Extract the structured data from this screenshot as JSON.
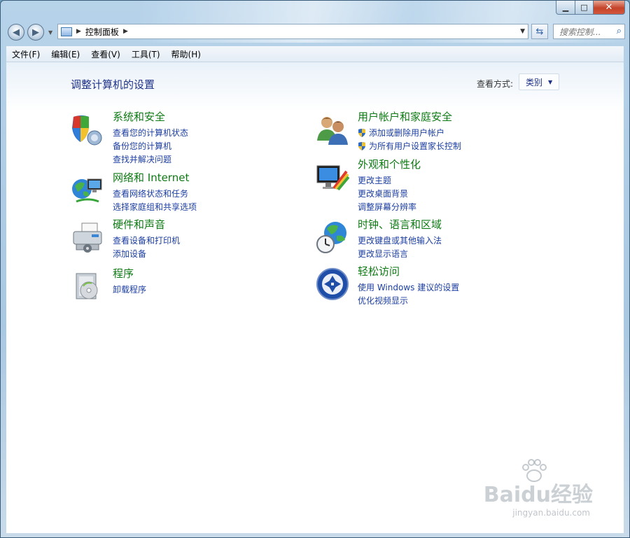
{
  "window": {
    "title": ""
  },
  "caption": {
    "minimize": "▁",
    "maximize": "□",
    "close": "✕"
  },
  "nav": {
    "back_icon": "back-arrow-icon",
    "forward_icon": "forward-arrow-icon",
    "breadcrumb": [
      "控制面板"
    ],
    "search_placeholder": "搜索控制..."
  },
  "menu": [
    "文件(F)",
    "编辑(E)",
    "查看(V)",
    "工具(T)",
    "帮助(H)"
  ],
  "main": {
    "title": "调整计算机的设置",
    "view_by_label": "查看方式:",
    "view_by_value": "类别",
    "categories_left": [
      {
        "icon": "shield-pc-icon",
        "title": "系统和安全",
        "links": [
          "查看您的计算机状态",
          "备份您的计算机",
          "查找并解决问题"
        ]
      },
      {
        "icon": "network-globe-icon",
        "title": "网络和 Internet",
        "links": [
          "查看网络状态和任务",
          "选择家庭组和共享选项"
        ]
      },
      {
        "icon": "printer-icon",
        "title": "硬件和声音",
        "links": [
          "查看设备和打印机",
          "添加设备"
        ]
      },
      {
        "icon": "programs-box-icon",
        "title": "程序",
        "links": [
          "卸载程序"
        ]
      }
    ],
    "categories_right": [
      {
        "icon": "users-icon",
        "title": "用户帐户和家庭安全",
        "links": [
          "添加或删除用户帐户",
          "为所有用户设置家长控制"
        ],
        "shielded": true
      },
      {
        "icon": "display-palette-icon",
        "title": "外观和个性化",
        "links": [
          "更改主题",
          "更改桌面背景",
          "调整屏幕分辨率"
        ]
      },
      {
        "icon": "clock-globe-icon",
        "title": "时钟、语言和区域",
        "links": [
          "更改键盘或其他输入法",
          "更改显示语言"
        ]
      },
      {
        "icon": "ease-of-access-icon",
        "title": "轻松访问",
        "links": [
          "使用 Windows 建议的设置",
          "优化视频显示"
        ]
      }
    ]
  },
  "watermark": {
    "text": "Baidu经验",
    "url": "jingyan.baidu.com"
  }
}
